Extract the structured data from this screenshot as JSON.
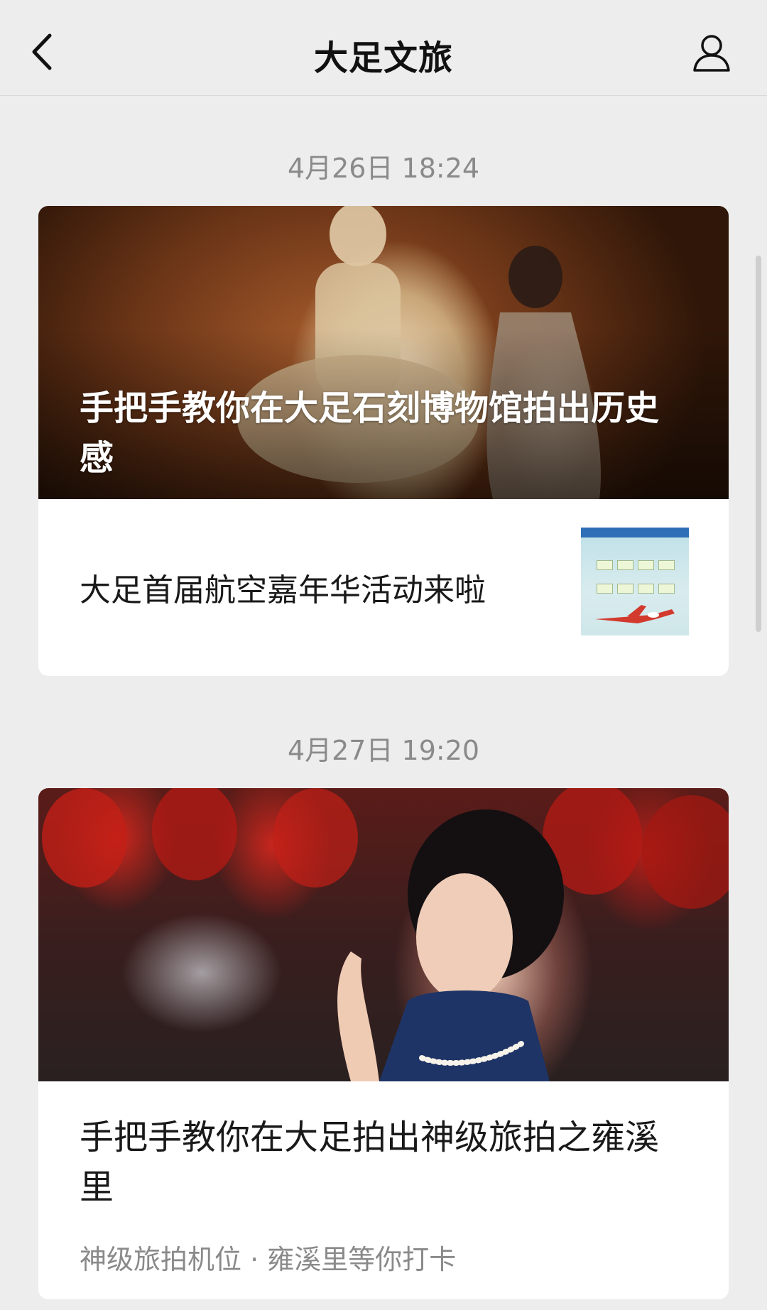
{
  "header": {
    "title": "大足文旅"
  },
  "messages": [
    {
      "timestamp": "4月26日 18:24",
      "hero_title": "手把手教你在大足石刻博物馆拍出历史感",
      "sub_title": "大足首届航空嘉年华活动来啦"
    },
    {
      "timestamp": "4月27日 19:20",
      "title": "手把手教你在大足拍出神级旅拍之雍溪里",
      "subtitle": "神级旅拍机位 · 雍溪里等你打卡"
    }
  ],
  "icons": {
    "back": "chevron-left-icon",
    "profile": "user-icon"
  },
  "colors": {
    "background": "#ededed",
    "card": "#ffffff",
    "timestamp": "#8a8a8a"
  }
}
